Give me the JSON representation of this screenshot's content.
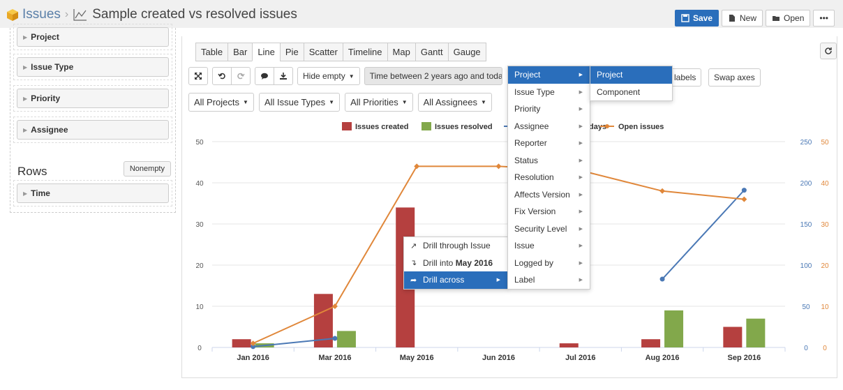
{
  "header": {
    "root": "Issues",
    "separator": "›",
    "title": "Sample created vs resolved issues",
    "buttons": {
      "save": "Save",
      "new": "New",
      "open": "Open",
      "more": "•••"
    }
  },
  "left_panel": {
    "dimensions": [
      "Project",
      "Issue Type",
      "Priority",
      "Assignee"
    ],
    "rows_label": "Rows",
    "nonempty_label": "Nonempty",
    "rows": [
      "Time"
    ]
  },
  "tabs": [
    "Table",
    "Bar",
    "Line",
    "Pie",
    "Scatter",
    "Timeline",
    "Map",
    "Gantt",
    "Gauge"
  ],
  "active_tab": "Line",
  "toolbar": {
    "hide_empty": "Hide empty",
    "time_filter": "Time between 2 years ago and today",
    "labels": "labels",
    "swap_axes": "Swap axes"
  },
  "filters": [
    "All Projects",
    "All Issue Types",
    "All Priorities",
    "All Assignees"
  ],
  "context_menu": {
    "items": [
      "Drill through Issue",
      "Drill into",
      "Drill across"
    ],
    "drill_into_target": "May 2016"
  },
  "drill_across_menu": [
    "Project",
    "Issue Type",
    "Priority",
    "Assignee",
    "Reporter",
    "Status",
    "Resolution",
    "Affects Version",
    "Fix Version",
    "Security Level",
    "Issue",
    "Logged by",
    "Label"
  ],
  "project_submenu": [
    "Project",
    "Component"
  ],
  "chart_data": {
    "type": "bar",
    "categories": [
      "Jan 2016",
      "Mar 2016",
      "May 2016",
      "Jun 2016",
      "Jul 2016",
      "Aug 2016",
      "Sep 2016"
    ],
    "series": [
      {
        "name": "Issues created",
        "type": "bar",
        "axis": "left",
        "color": "#b5403f",
        "values": [
          2,
          13,
          34,
          null,
          1,
          2,
          5
        ]
      },
      {
        "name": "Issues resolved",
        "type": "bar",
        "axis": "left",
        "color": "#82a84b",
        "values": [
          1,
          4,
          null,
          null,
          null,
          9,
          7
        ]
      },
      {
        "name": "days",
        "type": "line",
        "axis": "right_blue",
        "color": "#4a78b5",
        "values": [
          1,
          11,
          null,
          null,
          null,
          83,
          191
        ]
      },
      {
        "name": "Open issues",
        "type": "line",
        "axis": "right_orange",
        "color": "#e0873a",
        "values": [
          1,
          10,
          44,
          44,
          43,
          38,
          36
        ]
      }
    ],
    "left_axis": {
      "ylim": [
        0,
        50
      ],
      "ticks": [
        0,
        10,
        20,
        30,
        40,
        50
      ]
    },
    "right_axis_blue": {
      "ylim": [
        0,
        250
      ],
      "ticks": [
        0,
        50,
        100,
        150,
        200,
        250
      ]
    },
    "right_axis_orange": {
      "ylim": [
        0,
        50
      ],
      "ticks": [
        0,
        10,
        20,
        30,
        40,
        50
      ]
    },
    "legend_position": "top",
    "grid": true
  }
}
